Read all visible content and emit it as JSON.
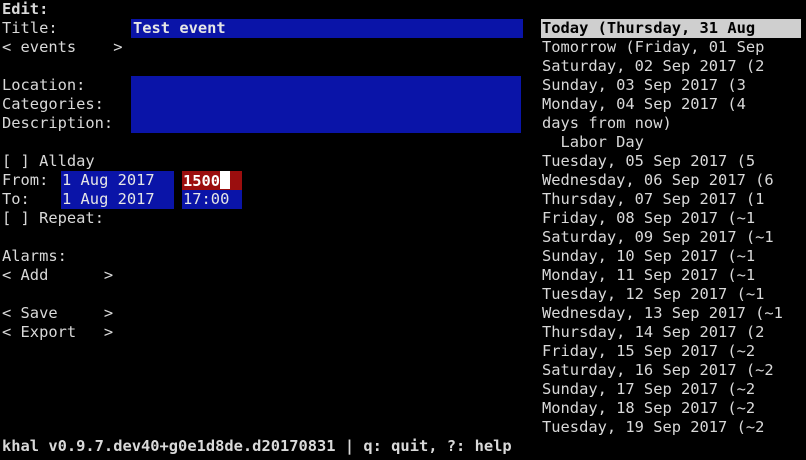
{
  "editor": {
    "heading": "Edit:",
    "title_label": "Title:",
    "title_value": "Test event",
    "calendar_selector": "< events    >",
    "location_label": "Location:",
    "categories_label": "Categories:",
    "description_label": "Description:",
    "allday_checkbox": "[ ]",
    "allday_label": "Allday",
    "from_label": "From:",
    "from_date": "1 Aug 2017 ",
    "from_time": "1500",
    "to_label": "To:",
    "to_date": "1 Aug 2017 ",
    "to_time": "17:00",
    "repeat_checkbox": "[ ]",
    "repeat_label": "Repeat:",
    "alarms_label": "Alarms:",
    "add_button": "< Add      >",
    "save_button": "< Save     >",
    "export_button": "< Export   >"
  },
  "day_list": [
    "Today (Thursday, 31 Aug",
    "Tomorrow (Friday, 01 Sep",
    "Saturday, 02 Sep 2017 (2",
    "Sunday, 03 Sep 2017 (3",
    "Monday, 04 Sep 2017 (4",
    "days from now)",
    "  Labor Day",
    "Tuesday, 05 Sep 2017 (5",
    "Wednesday, 06 Sep 2017 (6",
    "Thursday, 07 Sep 2017 (1",
    "Friday, 08 Sep 2017 (~1",
    "Saturday, 09 Sep 2017 (~1",
    "Sunday, 10 Sep 2017 (~1",
    "Monday, 11 Sep 2017 (~1",
    "Tuesday, 12 Sep 2017 (~1",
    "Wednesday, 13 Sep 2017 (~1",
    "Thursday, 14 Sep 2017 (2",
    "Friday, 15 Sep 2017 (~2",
    "Saturday, 16 Sep 2017 (~2",
    "Sunday, 17 Sep 2017 (~2",
    "Monday, 18 Sep 2017 (~2",
    "Tuesday, 19 Sep 2017 (~2"
  ],
  "status_bar": "khal v0.9.7.dev40+g0e1d8de.d20170831 | q: quit, ?: help",
  "colors": {
    "field_bg": "#0a14a8",
    "active_field_bg": "#9b0e0e",
    "today_highlight": "#cfcfcf",
    "background": "#000000"
  }
}
